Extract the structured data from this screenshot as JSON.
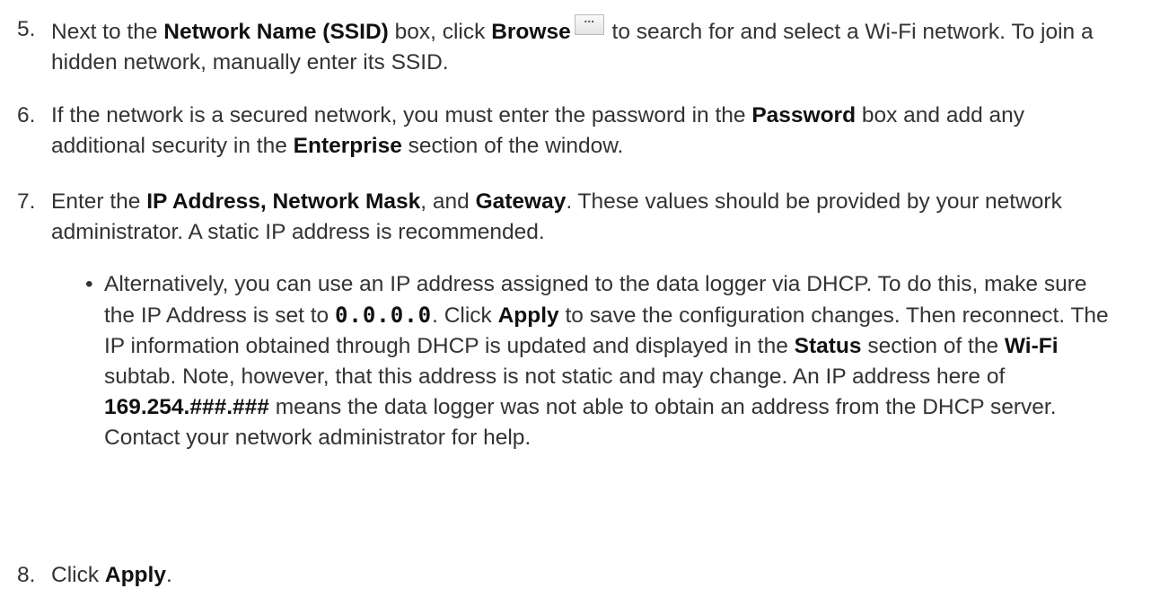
{
  "steps": [
    {
      "number": "5.",
      "parts": [
        "Next to the ",
        "Network Name (SSID)",
        " box, click ",
        "Browse",
        " to search for and select a Wi-Fi network. To join a hidden network, manually enter its SSID."
      ],
      "browse_icon": "ellipsis-button-icon"
    },
    {
      "number": "6.",
      "parts": [
        "If the network is a secured network, you must enter the password in the ",
        "Password",
        " box and add any additional security in the ",
        "Enterprise",
        " section of the window."
      ]
    },
    {
      "number": "7.",
      "parts": [
        "Enter the ",
        "IP Address, Network Mask",
        ", and ",
        "Gateway",
        ". These values should be provided by your network administrator. A static IP address is recommended."
      ]
    },
    {
      "number": "8.",
      "parts": [
        "Click ",
        "Apply",
        "."
      ]
    }
  ],
  "bullet": {
    "symbol": "•",
    "parts": [
      "Alternatively, you can use an IP address assigned to the data logger via DHCP. To do this, make sure the IP Address is set to ",
      "0.0.0.0",
      ". Click ",
      "Apply",
      " to save the configuration changes. Then reconnect. The IP information obtained through DHCP is updated and displayed in the ",
      "Status",
      " section of the ",
      "Wi-Fi",
      " subtab. Note, however, that this address is not static and may change. An IP address here of ",
      "169.254.###.###",
      " means the data logger was not able to obtain an address from the DHCP server. Contact your network administrator for help."
    ]
  }
}
